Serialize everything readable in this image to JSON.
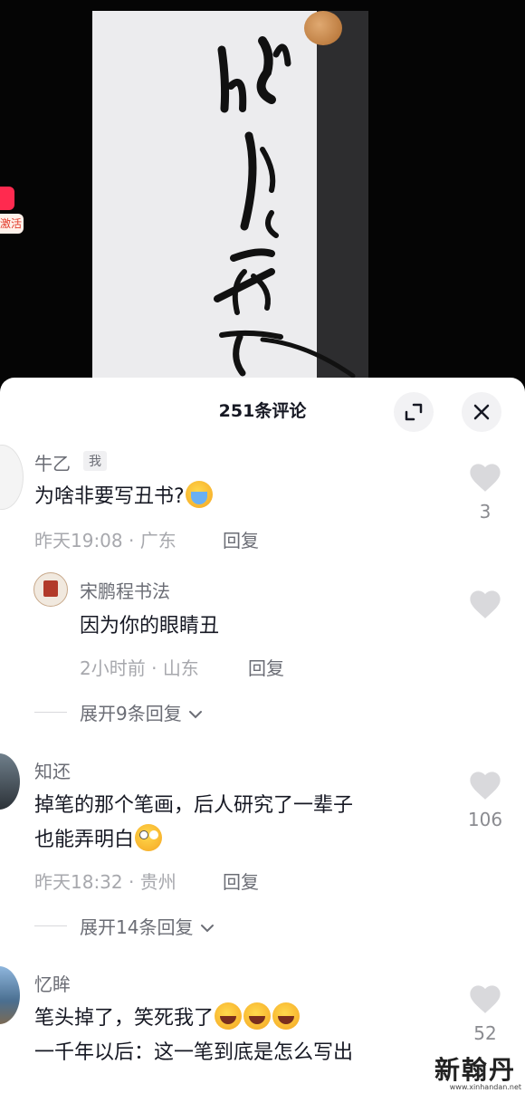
{
  "video": {
    "side_badge_label": "激活"
  },
  "panel": {
    "title": "251条评论"
  },
  "icons": {
    "expand": "expand-icon",
    "close": "close-icon",
    "like": "heart-icon",
    "chevron": "chevron-down-icon"
  },
  "comments": [
    {
      "user": "牛乙",
      "tag": "我",
      "text": "为啥非要写丑书?",
      "emoji": "crying-face",
      "time": "昨天19:08",
      "location": "广东",
      "reply_label": "回复",
      "likes": "3",
      "reply": {
        "user": "宋鹏程书法",
        "text": "因为你的眼睛丑",
        "time": "2小时前",
        "location": "山东",
        "reply_label": "回复"
      },
      "expand_label": "展开9条回复"
    },
    {
      "user": "知还",
      "text_line1": "掉笔的那个笔画，后人研究了一辈子",
      "text_line2": "也能弄明白",
      "emoji": "eye-roll-face",
      "time": "昨天18:32",
      "location": "贵州",
      "reply_label": "回复",
      "likes": "106",
      "expand_label": "展开14条回复"
    },
    {
      "user": "忆眸",
      "text_line1": "笔头掉了，笑死我了",
      "text_line2": "一千年以后：这一笔到底是怎么写出",
      "emoji": "laughing-face",
      "likes": "52"
    }
  ],
  "watermark": {
    "brand": "新翰丹",
    "url": "www.xinhandan.net"
  },
  "colors": {
    "panel_bg": "#ffffff",
    "text_primary": "#161823",
    "text_secondary": "#6b6d75",
    "text_meta": "#a7a8ad",
    "heart": "#d9d9dc",
    "badge_red": "#ff2a4f"
  }
}
